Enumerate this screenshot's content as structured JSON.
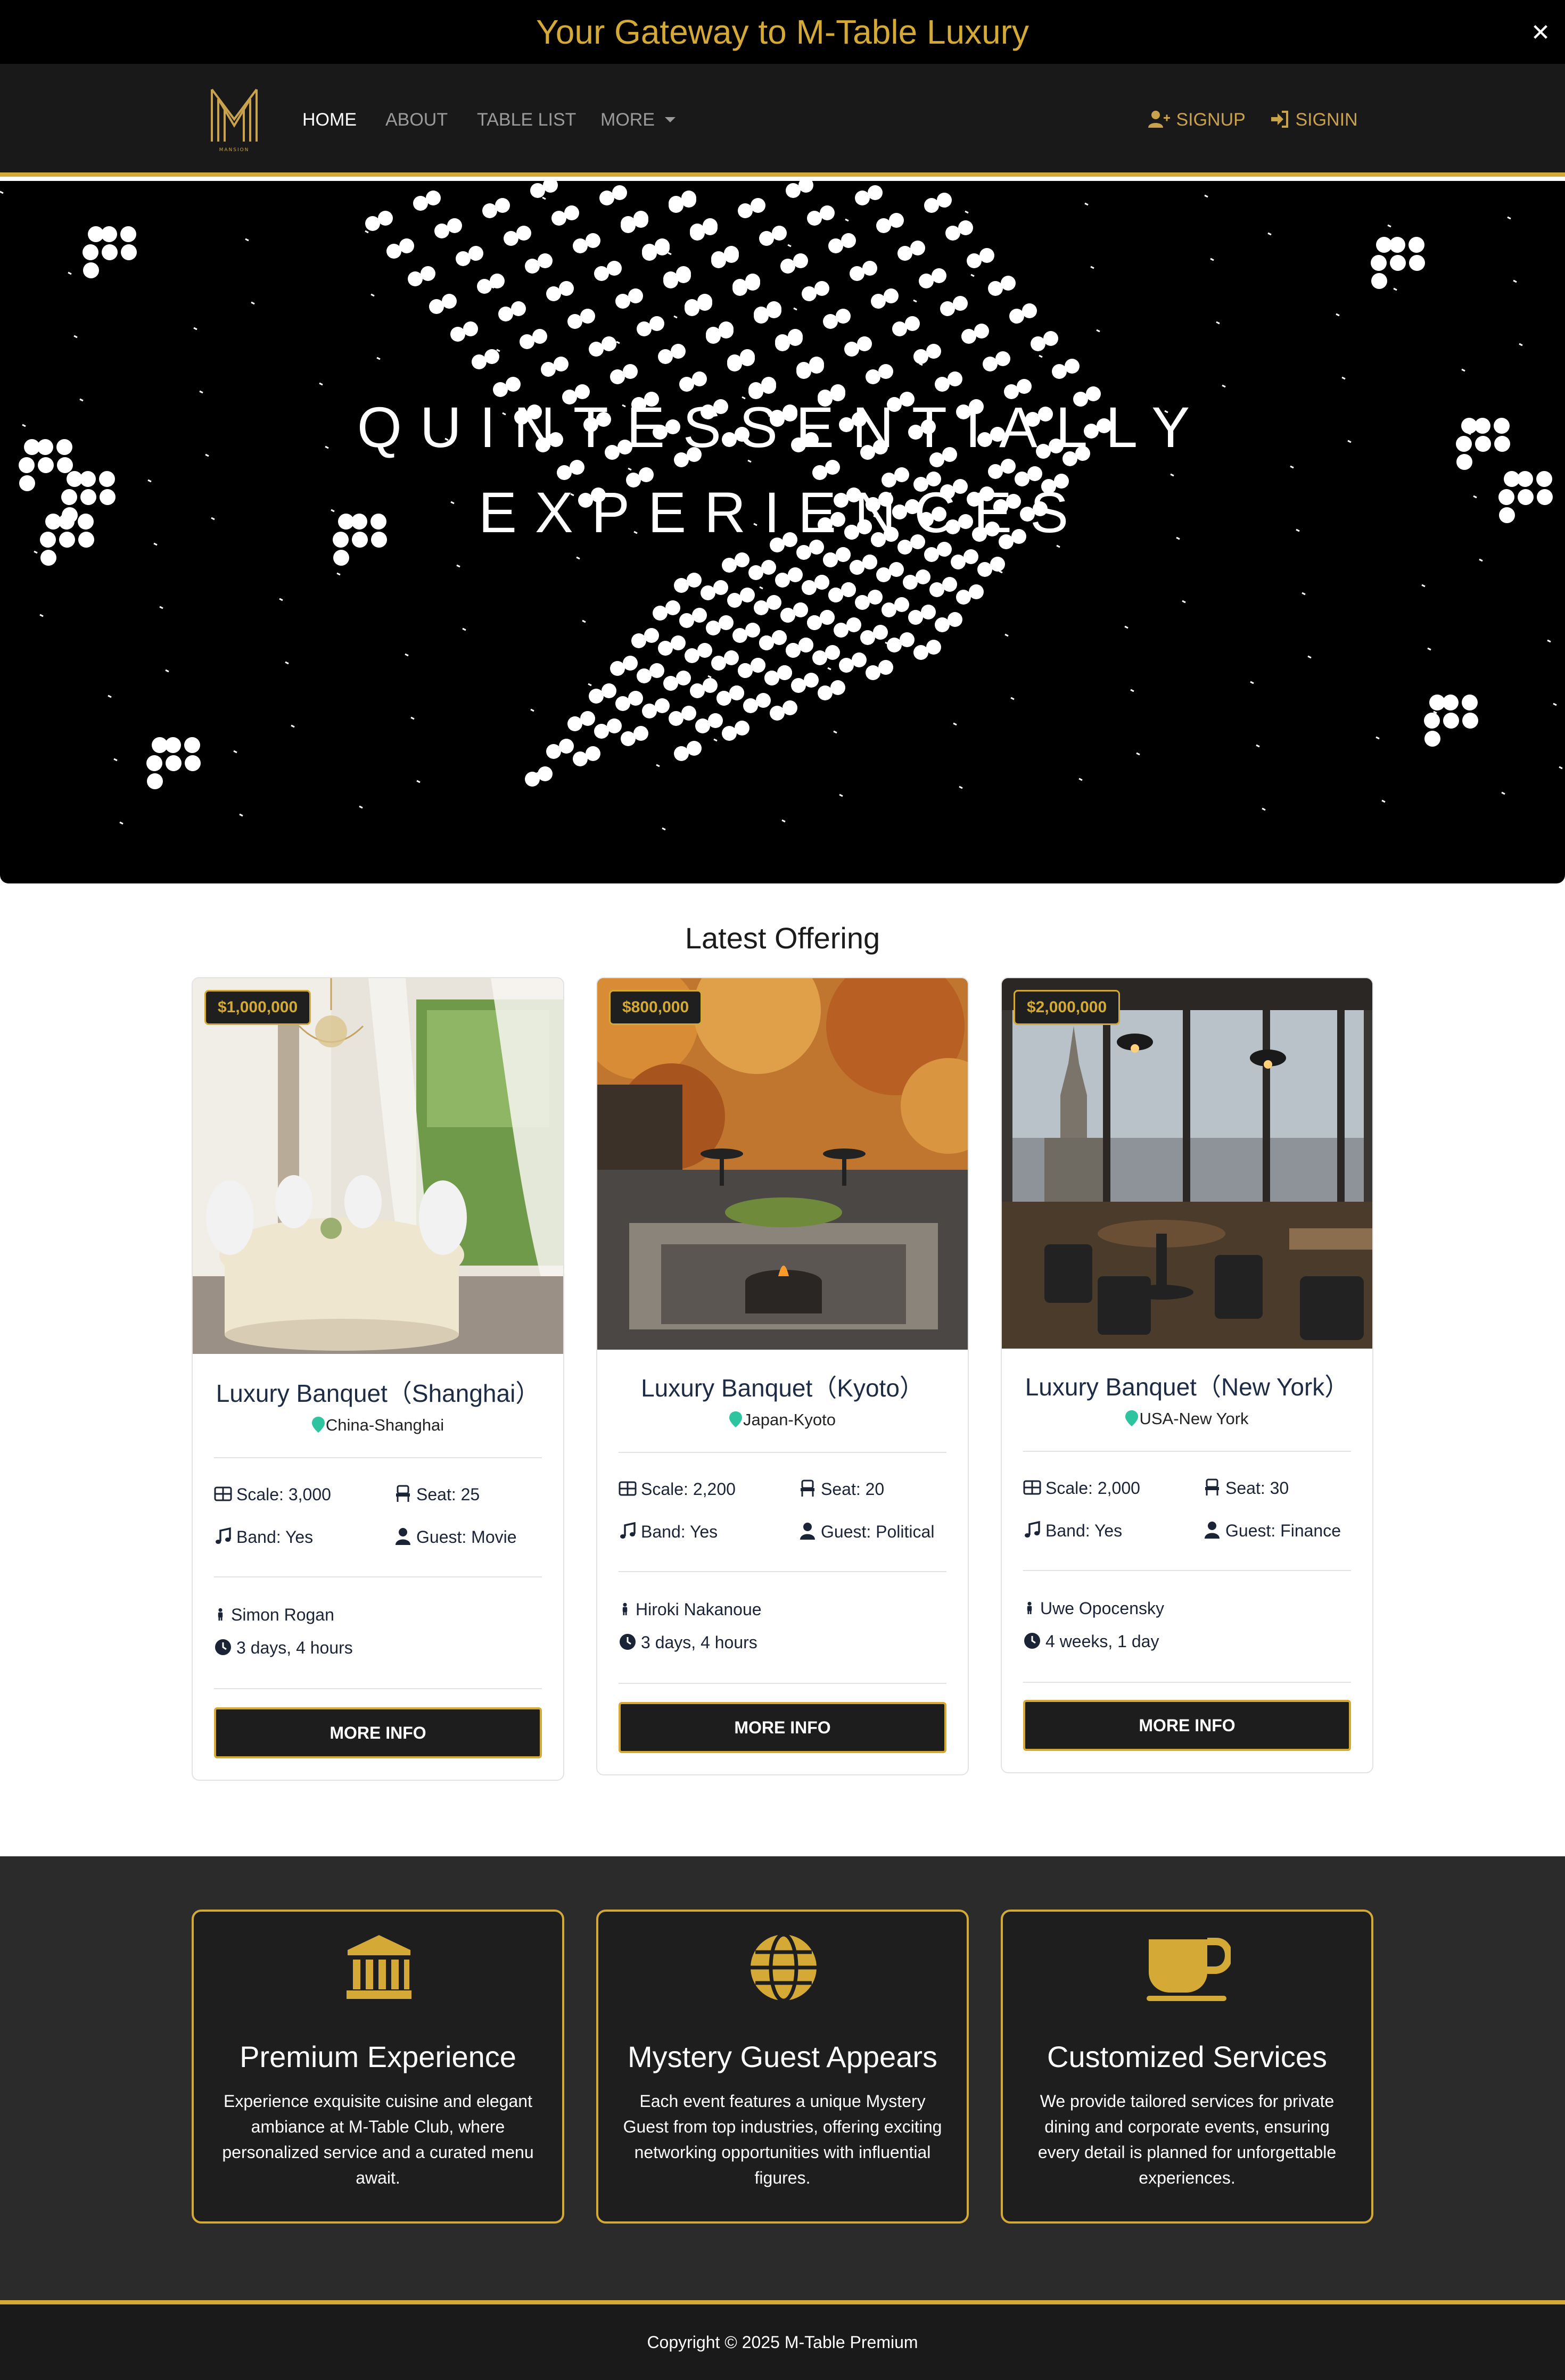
{
  "banner": {
    "title": "Your Gateway to M-Table Luxury",
    "close": "✕"
  },
  "nav": {
    "logo_text": "MANSION",
    "links": [
      "HOME",
      "ABOUT",
      "TABLE LIST",
      "MORE"
    ],
    "signup": "SIGNUP",
    "signin": "SIGNIN"
  },
  "hero": {
    "line1": "QUINTESSENTIALLY",
    "line2": "EXPERIENCES"
  },
  "offering": {
    "title": "Latest Offering",
    "cards": [
      {
        "price": "$1,000,000",
        "title": "Luxury Banquet（Shanghai）",
        "location": "China-Shanghai",
        "scale": "Scale: 3,000",
        "seat": "Seat: 25",
        "band": "Band: Yes",
        "guest": "Guest: Movie",
        "host": "Simon Rogan",
        "time": "3 days, 4 hours",
        "button": "MORE INFO"
      },
      {
        "price": "$800,000",
        "title": "Luxury Banquet（Kyoto）",
        "location": "Japan-Kyoto",
        "scale": "Scale: 2,200",
        "seat": "Seat: 20",
        "band": "Band: Yes",
        "guest": "Guest: Political",
        "host": "Hiroki Nakanoue",
        "time": "3 days, 4 hours",
        "button": "MORE INFO"
      },
      {
        "price": "$2,000,000",
        "title": "Luxury Banquet（New York）",
        "location": "USA-New York",
        "scale": "Scale: 2,000",
        "seat": "Seat: 30",
        "band": "Band: Yes",
        "guest": "Guest: Finance",
        "host": "Uwe Opocensky",
        "time": "4 weeks, 1 day",
        "button": "MORE INFO"
      }
    ]
  },
  "features": [
    {
      "icon": "bank-icon",
      "title": "Premium Experience",
      "text": "Experience exquisite cuisine and elegant ambiance at M-Table Club, where personalized service and a curated menu await."
    },
    {
      "icon": "globe-icon",
      "title": "Mystery Guest Appears",
      "text": "Each event features a unique Mystery Guest from top industries, offering exciting networking opportunities with influential figures."
    },
    {
      "icon": "coffee-cup-icon",
      "title": "Customized Services",
      "text": "We provide tailored services for private dining and corporate events, ensuring every detail is planned for unforgettable experiences."
    }
  ],
  "footer": {
    "copyright": "Copyright © 2025 M-Table Premium"
  },
  "colors": {
    "gold": "#d4a935",
    "dark": "#191919",
    "location_pin": "#2ec4a0"
  }
}
